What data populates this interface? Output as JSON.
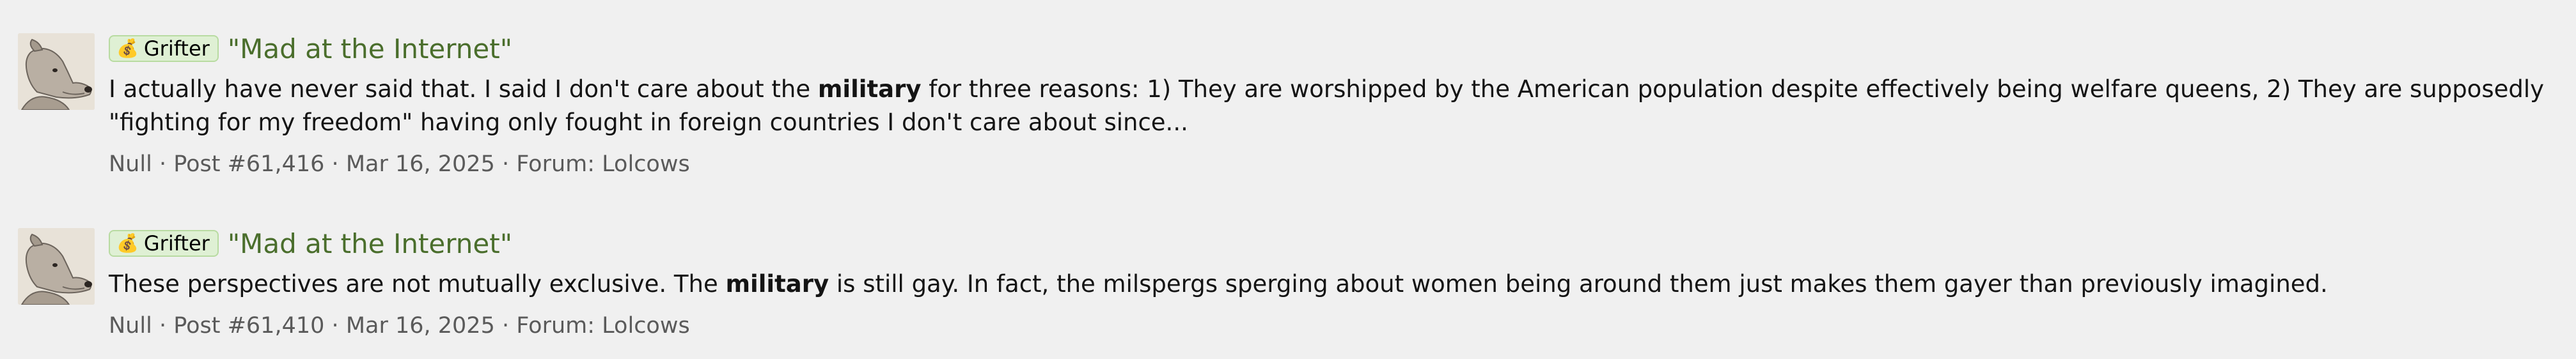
{
  "results": [
    {
      "label": "Grifter",
      "label_icon": "money-bag-icon",
      "thread_title": "\"Mad at the Internet\"",
      "snippet_before": "I actually have never said that. I said I don't care about the ",
      "snippet_bold": "military",
      "snippet_after": " for three reasons: 1) They are worshipped by the American population despite effectively being welfare queens, 2) They are supposedly \"fighting for my freedom\" having only fought in foreign countries I don't care about since...",
      "author": "Null",
      "post": "Post #61,416",
      "date": "Mar 16, 2025",
      "forum_prefix": "Forum:",
      "forum": "Lolcows",
      "sep": "·"
    },
    {
      "label": "Grifter",
      "label_icon": "money-bag-icon",
      "thread_title": "\"Mad at the Internet\"",
      "snippet_before": "These perspectives are not mutually exclusive. The ",
      "snippet_bold": "military",
      "snippet_after": " is still gay. In fact, the milspergs sperging about women being around them just makes them gayer than previously imagined.",
      "author": "Null",
      "post": "Post #61,410",
      "date": "Mar 16, 2025",
      "forum_prefix": "Forum:",
      "forum": "Lolcows",
      "sep": "·"
    }
  ],
  "colors": {
    "background": "#f0f0f0",
    "title": "#4a6e2c",
    "label_bg": "#dff0d4",
    "label_border": "#b8dba1",
    "meta": "#5a5a5a"
  }
}
